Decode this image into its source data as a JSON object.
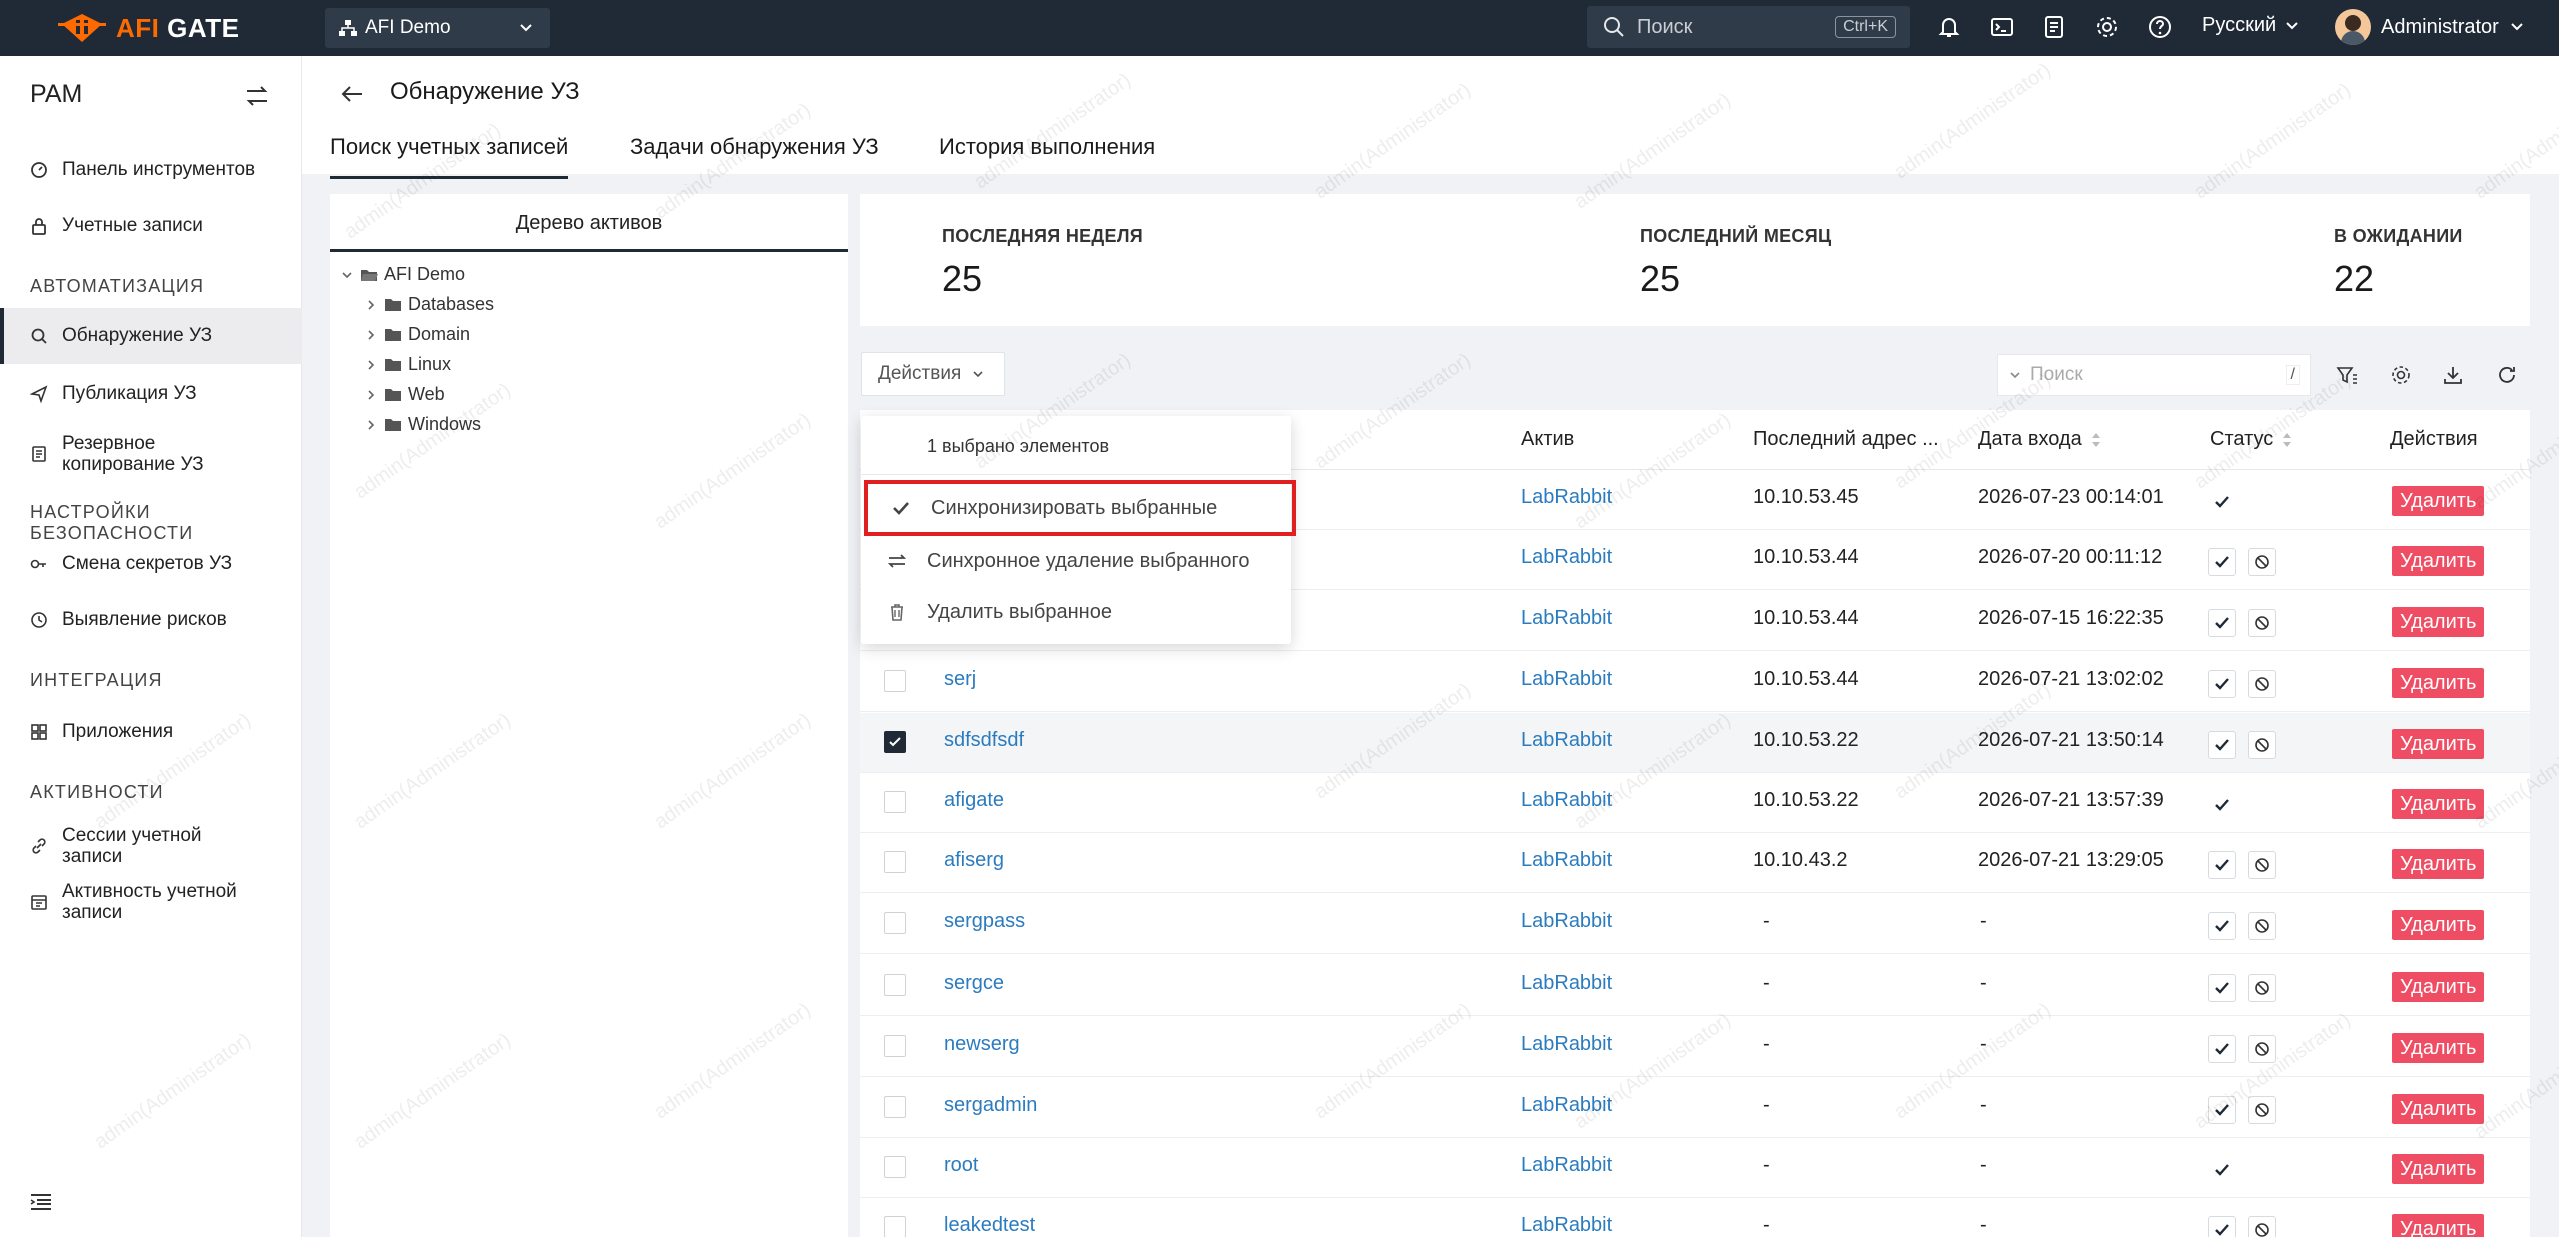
{
  "app": {
    "logo_afi": "AFI",
    "logo_gate": "GATE",
    "org": "AFI Demo",
    "search_placeholder": "Поиск",
    "search_shortcut": "Ctrl+K",
    "language": "Русский",
    "user": "Administrator",
    "accent": "#ff6a00"
  },
  "sidebar": {
    "title": "PAM",
    "items": [
      {
        "label": "Панель инструментов",
        "icon": "dashboard-icon"
      },
      {
        "label": "Учетные записи",
        "icon": "lock-icon"
      },
      {
        "section": "АВТОМАТИЗАЦИЯ"
      },
      {
        "label": "Обнаружение УЗ",
        "icon": "search-icon",
        "active": true
      },
      {
        "label": "Публикация УЗ",
        "icon": "send-icon"
      },
      {
        "label": "Резервное копирование УЗ",
        "icon": "backup-icon"
      },
      {
        "section": "НАСТРОЙКИ БЕЗОПАСНОСТИ"
      },
      {
        "label": "Смена секретов УЗ",
        "icon": "key-icon"
      },
      {
        "label": "Выявление рисков",
        "icon": "clock-icon"
      },
      {
        "section": "ИНТЕГРАЦИЯ"
      },
      {
        "label": "Приложения",
        "icon": "apps-icon"
      },
      {
        "section": "АКТИВНОСТИ"
      },
      {
        "label": "Сессии учетной записи",
        "icon": "link-icon"
      },
      {
        "label": "Активность учетной записи",
        "icon": "calendar-icon"
      }
    ]
  },
  "page": {
    "title": "Обнаружение УЗ",
    "tabs": [
      "Поиск учетных записей",
      "Задачи обнаружения УЗ",
      "История выполнения"
    ]
  },
  "tree": {
    "title": "Дерево активов",
    "root": "AFI Demo",
    "children": [
      "Databases",
      "Domain",
      "Linux",
      "Web",
      "Windows"
    ]
  },
  "stats": [
    {
      "label": "ПОСЛЕДНЯЯ НЕДЕЛЯ",
      "value": "25"
    },
    {
      "label": "ПОСЛЕДНИЙ МЕСЯЦ",
      "value": "25"
    },
    {
      "label": "В ОЖИДАНИИ",
      "value": "22"
    }
  ],
  "toolbar": {
    "actions_label": "Действия",
    "search_placeholder": "Поиск",
    "search_key": "/"
  },
  "dropdown": {
    "info": "1 выбрано элементов",
    "items": [
      {
        "label": "Синхронизировать выбранные",
        "icon": "check-icon"
      },
      {
        "label": "Синхронное удаление выбранного",
        "icon": "swap-icon"
      },
      {
        "label": "Удалить выбранное",
        "icon": "trash-icon"
      }
    ]
  },
  "table": {
    "columns": [
      "Актив",
      "Последний адрес ...",
      "Дата входа",
      "Статус",
      "Действия"
    ],
    "delete_label": "Удалить",
    "rows": [
      {
        "name": "",
        "asset": "LabRabbit",
        "addr": "10.10.53.45",
        "date": "2026-07-23 00:14:01",
        "status": "ok",
        "checked": false
      },
      {
        "name": "",
        "asset": "LabRabbit",
        "addr": "10.10.53.44",
        "date": "2026-07-20 00:11:12",
        "status": "pending",
        "checked": false
      },
      {
        "name": "",
        "asset": "LabRabbit",
        "addr": "10.10.53.44",
        "date": "2026-07-15 16:22:35",
        "status": "pending",
        "checked": false
      },
      {
        "name": "serj",
        "asset": "LabRabbit",
        "addr": "10.10.53.44",
        "date": "2026-07-21 13:02:02",
        "status": "pending",
        "checked": false
      },
      {
        "name": "sdfsdfsdf",
        "asset": "LabRabbit",
        "addr": "10.10.53.22",
        "date": "2026-07-21 13:50:14",
        "status": "pending",
        "checked": true
      },
      {
        "name": "afigate",
        "asset": "LabRabbit",
        "addr": "10.10.53.22",
        "date": "2026-07-21 13:57:39",
        "status": "ok",
        "checked": false
      },
      {
        "name": "afiserg",
        "asset": "LabRabbit",
        "addr": "10.10.43.2",
        "date": "2026-07-21 13:29:05",
        "status": "pending",
        "checked": false
      },
      {
        "name": "sergpass",
        "asset": "LabRabbit",
        "addr": "-",
        "date": "-",
        "status": "pending",
        "checked": false
      },
      {
        "name": "sergce",
        "asset": "LabRabbit",
        "addr": "-",
        "date": "-",
        "status": "pending",
        "checked": false
      },
      {
        "name": "newserg",
        "asset": "LabRabbit",
        "addr": "-",
        "date": "-",
        "status": "pending",
        "checked": false
      },
      {
        "name": "sergadmin",
        "asset": "LabRabbit",
        "addr": "-",
        "date": "-",
        "status": "pending",
        "checked": false
      },
      {
        "name": "root",
        "asset": "LabRabbit",
        "addr": "-",
        "date": "-",
        "status": "ok",
        "checked": false
      },
      {
        "name": "leakedtest",
        "asset": "LabRabbit",
        "addr": "-",
        "date": "-",
        "status": "pending",
        "checked": false
      }
    ]
  },
  "watermark": "admin(Administrator)"
}
